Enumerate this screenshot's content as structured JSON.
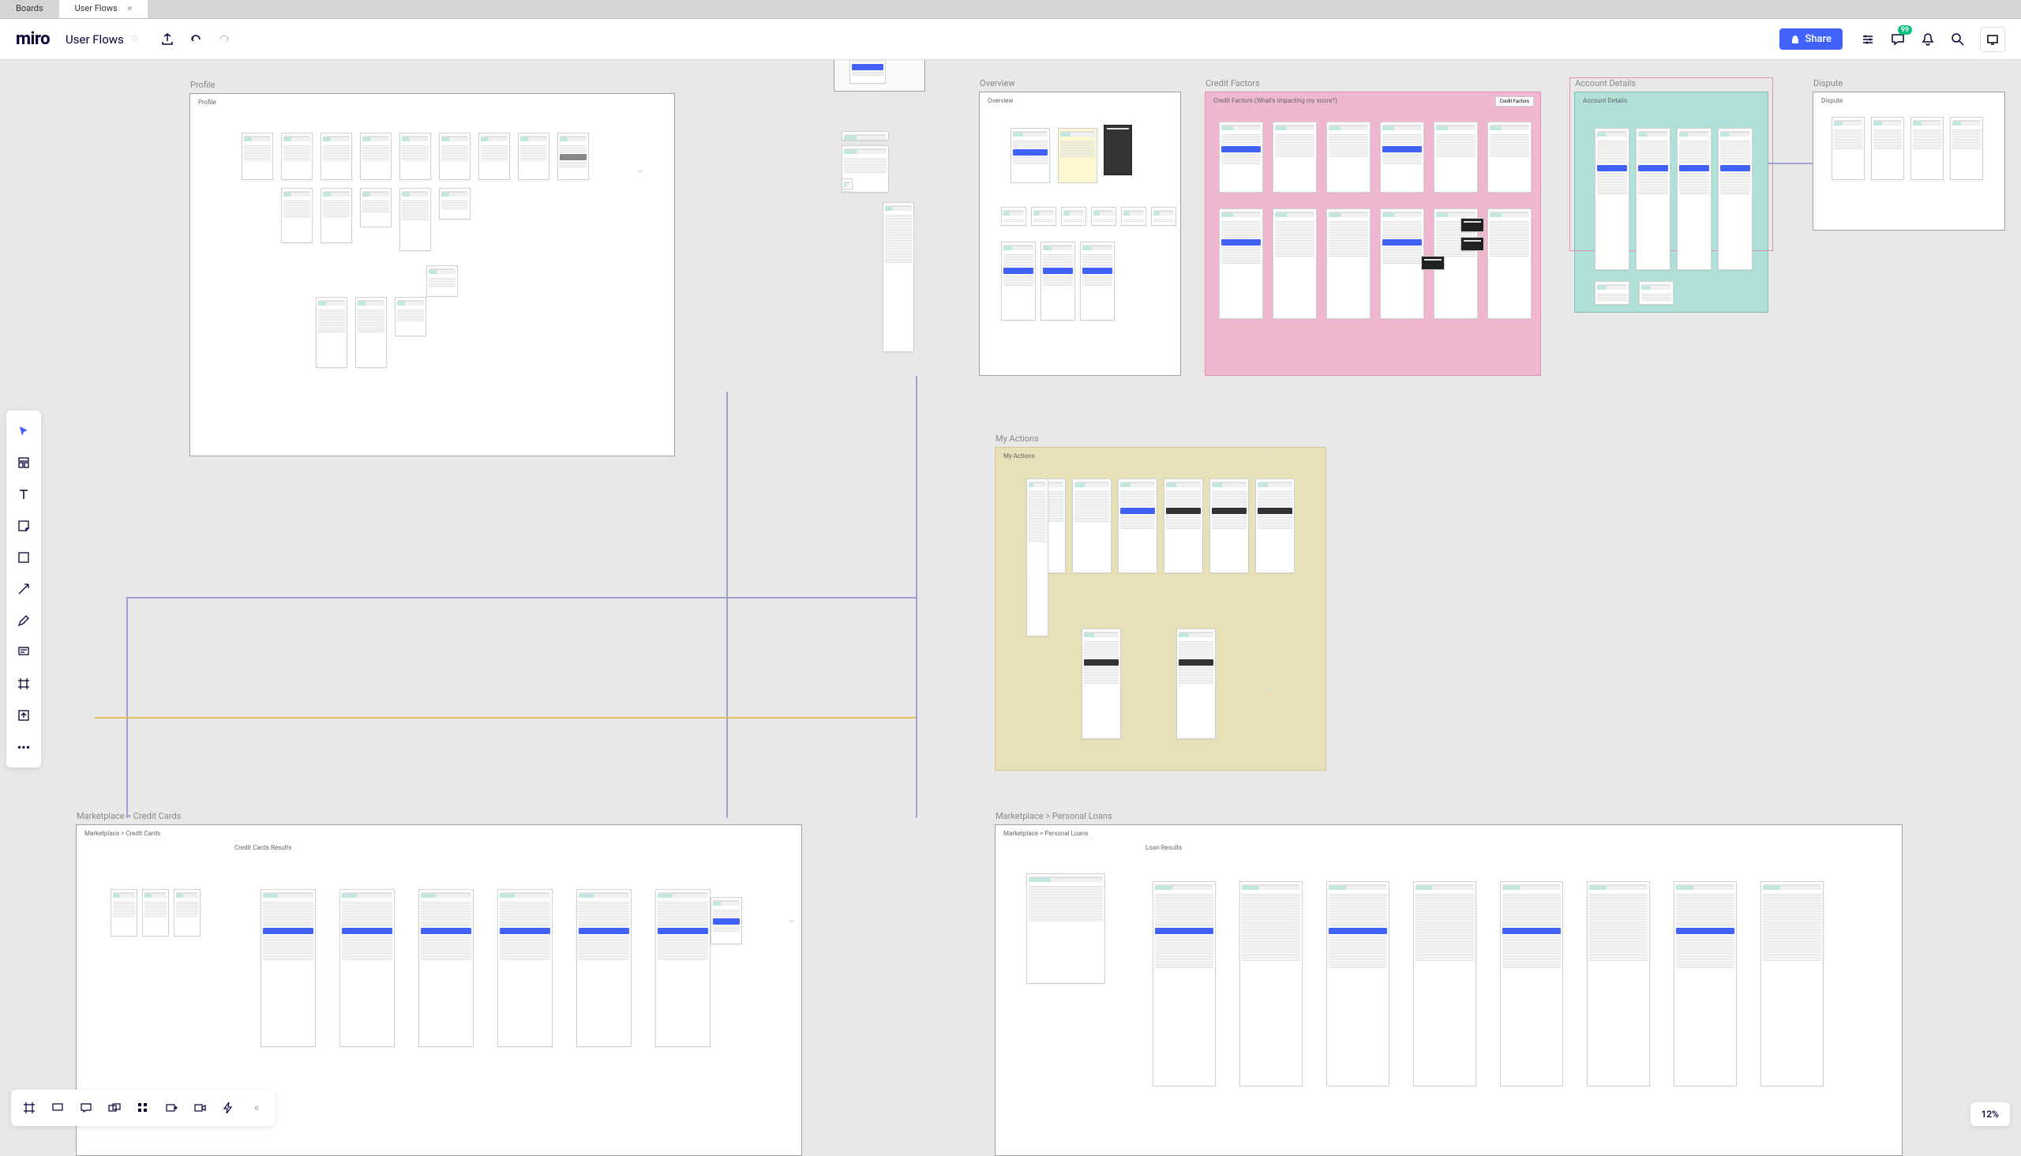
{
  "tabs": {
    "boards": "Boards",
    "userflows": "User Flows"
  },
  "header": {
    "logo": "miro",
    "board_name": "User Flows",
    "share": "Share"
  },
  "badge_count": "99",
  "zoom": "12%",
  "frames": {
    "profile": {
      "title": "Profile",
      "label": "Profile"
    },
    "overview": {
      "title": "Overview",
      "label": "Overview"
    },
    "credit_factors": {
      "title": "Credit Factors",
      "label": "Credit Factors (What's impacting my score?)"
    },
    "account_details": {
      "title": "Account Details",
      "label": "Account Details"
    },
    "dispute": {
      "title": "Dispute",
      "label": "Dispute"
    },
    "my_actions": {
      "title": "My Actions",
      "label": "My Actions"
    },
    "marketplace_cc": {
      "title": "Marketplace > Credit Cards",
      "label": "Marketplace > Credit Cards",
      "sublabel": "Credit Cards Results"
    },
    "marketplace_pl": {
      "title": "Marketplace > Personal Loans",
      "label": "Marketplace > Personal Loans",
      "sublabel": "Loan Results"
    }
  },
  "credit_factors_tag": "Credit Factors"
}
